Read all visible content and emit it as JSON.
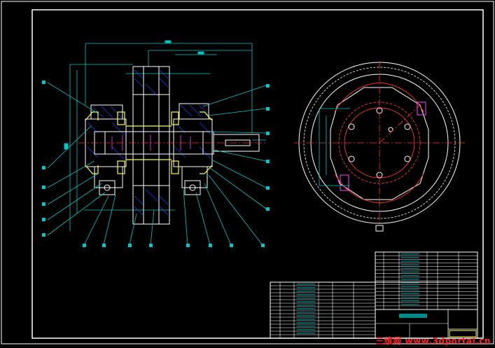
{
  "watermark": "三维网 www.3dportal.cn",
  "colors": {
    "background": "#000000",
    "frame": "#ffffff",
    "outline": "#ffffff",
    "hatch": "#2040ff",
    "part": "#ffff40",
    "dimension": "#00c8c8",
    "center": "#ff3030",
    "magenta": "#ff40ff",
    "table": "#ffffff",
    "watermark": "#ff2020"
  }
}
